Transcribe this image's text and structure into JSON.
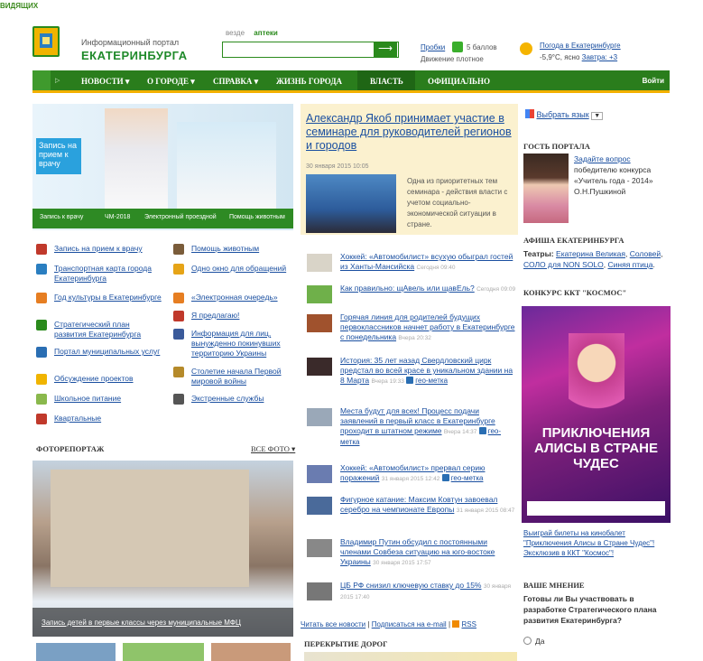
{
  "topstrip": "ВИДЯЩИХ",
  "header": {
    "portal_small": "Информационный портал",
    "portal_big": "ЕКАТЕРИНБУРГА",
    "search_tabs": [
      "везде",
      "аптеки"
    ],
    "search_btn": "⟶",
    "probki": "Пробки",
    "balls": "5 баллов",
    "dvizh": "Движение плотное",
    "weather_link": "Погода в Екатеринбурге",
    "weather_now": "-5,9°С, ясно",
    "weather_tomorrow": "Завтра: +3"
  },
  "nav": {
    "items": [
      "НОВОСТИ",
      "О ГОРОДЕ",
      "СПРАВКА",
      "ЖИЗНЬ ГОРОДА",
      "ВЛАСТЬ",
      "ОФИЦИАЛЬНО"
    ],
    "login": "Войти"
  },
  "banner": {
    "label": "Запись на прием к врачу",
    "tabs": [
      "Запись к врачу",
      "ЧМ-2018",
      "Электронный проездной",
      "Помощь животным"
    ]
  },
  "links": [
    {
      "text": "Запись на прием к врачу",
      "icon": "doctor-icon",
      "color": "#c0392b"
    },
    {
      "text": "Транспортная карта города Екатеринбурга",
      "icon": "bus-icon",
      "color": "#2a7ec0"
    },
    {
      "text": "Год культуры в Екатеринбурге",
      "icon": "pen-icon",
      "color": "#e67e22"
    },
    {
      "text": "Стратегический план развития Екатеринбурга",
      "icon": "plan-icon",
      "color": "#2a8a1c"
    },
    {
      "text": "Портал муниципальных услуг",
      "icon": "portal-icon",
      "color": "#2a6eb3"
    },
    {
      "text": "Обсуждение проектов",
      "icon": "chat-icon",
      "color": "#f0b400"
    },
    {
      "text": "Школьное питание",
      "icon": "food-icon",
      "color": "#8ab84c"
    },
    {
      "text": "Квартальные",
      "icon": "person-icon",
      "color": "#c0392b"
    },
    {
      "text": "Помощь животным",
      "icon": "animal-icon",
      "color": "#7a5c3a"
    },
    {
      "text": "Одно окно для обращений",
      "icon": "window-icon",
      "color": "#e6a417"
    },
    {
      "text": "«Электронная очередь»",
      "icon": "queue-icon",
      "color": "#e67e22"
    },
    {
      "text": "Я предлагаю!",
      "icon": "idea-icon",
      "color": "#c0392b"
    },
    {
      "text": "Информация для лиц, вынужденно покинувших территорию Украины",
      "icon": "info-icon",
      "color": "#3a5a9a"
    },
    {
      "text": "Столетие начала Первой мировой войны",
      "icon": "star-icon",
      "color": "#b58a2a"
    },
    {
      "text": "Экстренные службы",
      "icon": "emergency-icon",
      "color": "#555555"
    }
  ],
  "photo": {
    "title": "ФОТОРЕПОРТАЖ",
    "all": "ВСЕ ФОТО",
    "caption": "Запись детей в первые классы через муниципальные МФЦ"
  },
  "lead": {
    "title": "Александр Якоб принимает участие в семинаре для руководителей регионов и городов",
    "date": "30 января 2015 10:05",
    "text": "Одна из приоритетных тем семинара - действия власти с учетом социально-экономической ситуации в стране."
  },
  "news": [
    {
      "title": "Хоккей: «Автомобилист» всухую обыграл гостей из Ханты-Мансийска",
      "date": "Сегодня 09:40",
      "geo": ""
    },
    {
      "title": "Как правильно: щАвель или щавЕль?",
      "date": "Сегодня 09:09",
      "geo": ""
    },
    {
      "title": "Горячая линия для родителей будущих первоклассников начнет работу в Екатеринбурге с понедельника",
      "date": "Вчера 20:32",
      "geo": ""
    },
    {
      "title": "История: 35 лет назад Свердловский цирк предстал во всей красе в уникальном здании на 8 Марта",
      "date": "Вчера 19:33",
      "geo": "гео-метка"
    },
    {
      "title": "Места будут для всех! Процесс подачи заявлений в первый класс в Екатеринбурге проходит в штатном режиме",
      "date": "Вчера 14:37",
      "geo": "гео-метка"
    },
    {
      "title": "Хоккей: «Автомобилист» прервал серию поражений",
      "date": "31 января 2015 12:42",
      "geo": "гео-метка"
    },
    {
      "title": "Фигурное катание: Максим Ковтун завоевал серебро на чемпионате Европы",
      "date": "31 января 2015 08:47",
      "geo": ""
    },
    {
      "title": "Владимир Путин обсудил с постоянными членами Совбеза ситуацию на юго-востоке Украины",
      "date": "30 января 2015 17:57",
      "geo": ""
    },
    {
      "title": "ЦБ РФ снизил ключевую ставку до 15%",
      "date": "30 января 2015 17:40",
      "geo": ""
    }
  ],
  "news_footer": {
    "all": "Читать все новости",
    "sub": "Подписаться на e-mail",
    "rss": "RSS"
  },
  "roads_title": "ПЕРЕКРЫТИЕ ДОРОГ",
  "col3": {
    "lang": "Выбрать язык",
    "guest_title": "ГОСТЬ ПОРТАЛА",
    "guest_link": "Задайте вопрос",
    "guest_text": "победителю конкурса «Учитель года - 2014» О.Н.Пушкиной",
    "afisha_title": "АФИША ЕКАТЕРИНБУРГА",
    "theatres_label": "Театры:",
    "theatres": [
      "Екатерина Великая",
      "Соловей",
      "СОЛО для NON SOLO",
      "Синяя птица"
    ],
    "contest_title": "КОНКУРС ККТ \"КОСМОС\"",
    "poster_title": "ПРИКЛЮЧЕНИЯ АЛИСЫ В СТРАНЕ ЧУДЕС",
    "poster_link": "Выиграй билеты на кинобалет \"Приключения Алисы в Стране Чудес\"! Эксклюзив в ККТ \"Космос\"!",
    "opinion_title": "ВАШЕ МНЕНИЕ",
    "opinion_q": "Готовы ли Вы участвовать в разработке Стратегического плана развития Екатеринбурга?",
    "opinion_yes": "Да"
  }
}
